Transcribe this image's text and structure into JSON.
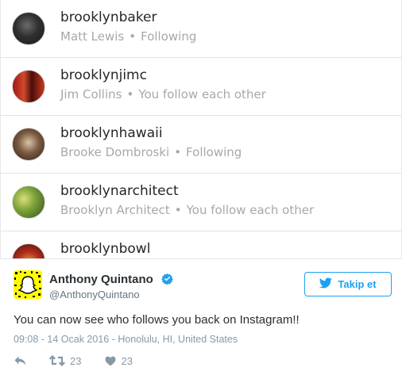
{
  "following_list": [
    {
      "username": "brooklynbaker",
      "fullname": "Matt Lewis",
      "status": "Following"
    },
    {
      "username": "brooklynjimc",
      "fullname": "Jim Collins",
      "status": "You follow each other"
    },
    {
      "username": "brooklynhawaii",
      "fullname": "Brooke Dombroski",
      "status": "Following"
    },
    {
      "username": "brooklynarchitect",
      "fullname": "Brooklyn Architect",
      "status": "You follow each other"
    },
    {
      "username": "brooklynbowl",
      "fullname": "",
      "status": ""
    }
  ],
  "separator": "•",
  "tweet": {
    "author_name": "Anthony Quintano",
    "author_handle": "@AnthonyQuintano",
    "follow_label": "Takip et",
    "text": "You can now see who follows you back on Instagram!!",
    "meta": "09:08 - 14 Ocak 2016 - Honolulu, HI, United States",
    "retweets": "23",
    "likes": "23"
  },
  "colors": {
    "twitter_blue": "#1da1f2",
    "muted": "#8899a6",
    "snapchat_yellow": "#fffc00"
  },
  "icons": [
    "verified-badge-icon",
    "twitter-bird-icon",
    "reply-icon",
    "retweet-icon",
    "heart-icon",
    "snapcode-ghost-icon"
  ]
}
